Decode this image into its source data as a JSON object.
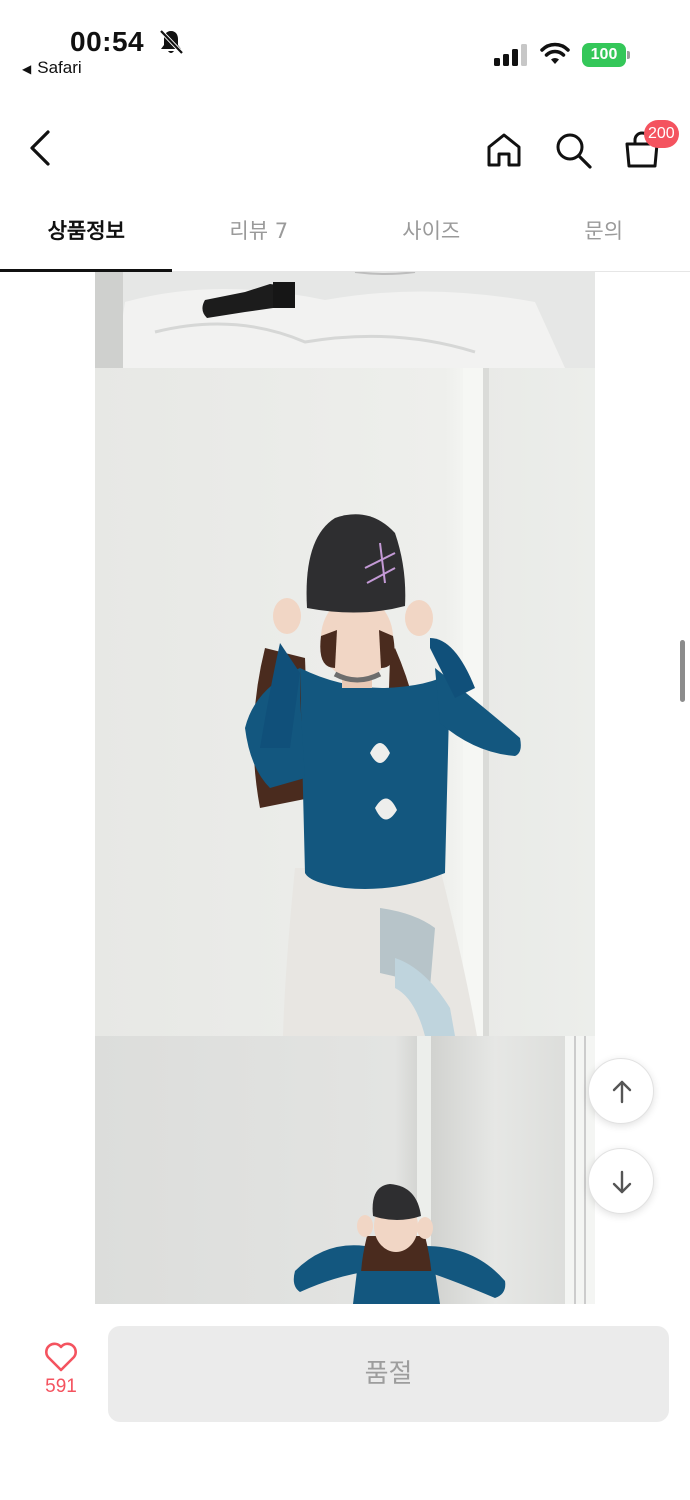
{
  "status_bar": {
    "time": "00:54",
    "back_app": "Safari",
    "battery": "100",
    "icons": [
      "bell-slash-icon",
      "cellular-signal-icon",
      "wifi-icon",
      "battery-icon"
    ]
  },
  "header": {
    "icons": [
      "back-arrow-icon",
      "home-icon",
      "search-icon",
      "shopping-bag-icon"
    ],
    "cart_badge": "200",
    "badge_color": "#f4535f"
  },
  "tabs": [
    {
      "label": "상품정보",
      "active": true
    },
    {
      "label": "리뷰 7",
      "active": false
    },
    {
      "label": "사이즈",
      "active": false
    },
    {
      "label": "문의",
      "active": false
    }
  ],
  "floating": {
    "icons": [
      "arrow-up-icon",
      "arrow-down-icon"
    ]
  },
  "bottom": {
    "like_count": "591",
    "soldout_label": "품절",
    "accent": "#f4535f"
  }
}
